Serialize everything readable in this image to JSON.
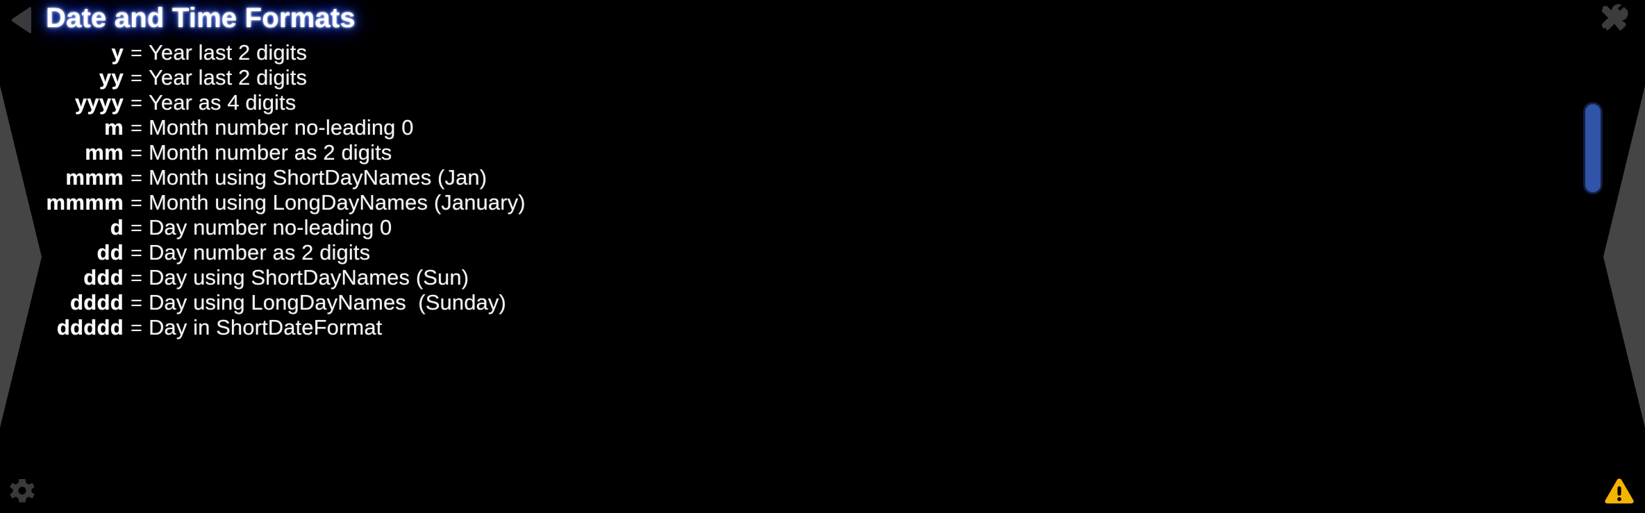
{
  "window": {
    "background_color": "#000000",
    "title": "Date and Time Formats",
    "title_color": "#ffffff",
    "title_glow_color": "#2a49c8"
  },
  "topbar": {
    "back_icon": "back-triangle-icon",
    "tools_icon": "tools-icon",
    "icon_color": "#3c3c3c"
  },
  "decor": {
    "left_chevron_icon": "left-edge-chevron",
    "right_chevron_icon": "right-edge-chevron",
    "chevron_color": "#454545"
  },
  "formats": {
    "separator": "=",
    "rows": [
      {
        "code": "y",
        "desc": "Year last 2 digits"
      },
      {
        "code": "yy",
        "desc": "Year last 2 digits"
      },
      {
        "code": "yyyy",
        "desc": "Year as 4 digits"
      },
      {
        "code": "m",
        "desc": "Month number no-leading 0"
      },
      {
        "code": "mm",
        "desc": "Month number as 2 digits"
      },
      {
        "code": "mmm",
        "desc": "Month using ShortDayNames (Jan)"
      },
      {
        "code": "mmmm",
        "desc": "Month using LongDayNames (January)"
      },
      {
        "code": "d",
        "desc": "Day number no-leading 0"
      },
      {
        "code": "dd",
        "desc": "Day number as 2 digits"
      },
      {
        "code": "ddd",
        "desc": "Day using ShortDayNames (Sun)"
      },
      {
        "code": "dddd",
        "desc": "Day using LongDayNames  (Sunday)"
      },
      {
        "code": "ddddd",
        "desc": "Day in ShortDateFormat"
      }
    ]
  },
  "scrollbar": {
    "thumb_color": "#2f54a8",
    "thumb_name": "vertical-scroll-thumb"
  },
  "statusbar": {
    "gear_icon": "gear-icon",
    "gear_color": "#3a3a3a",
    "warning_icon": "warning-triangle-icon",
    "warning_color": "#f5b400"
  }
}
